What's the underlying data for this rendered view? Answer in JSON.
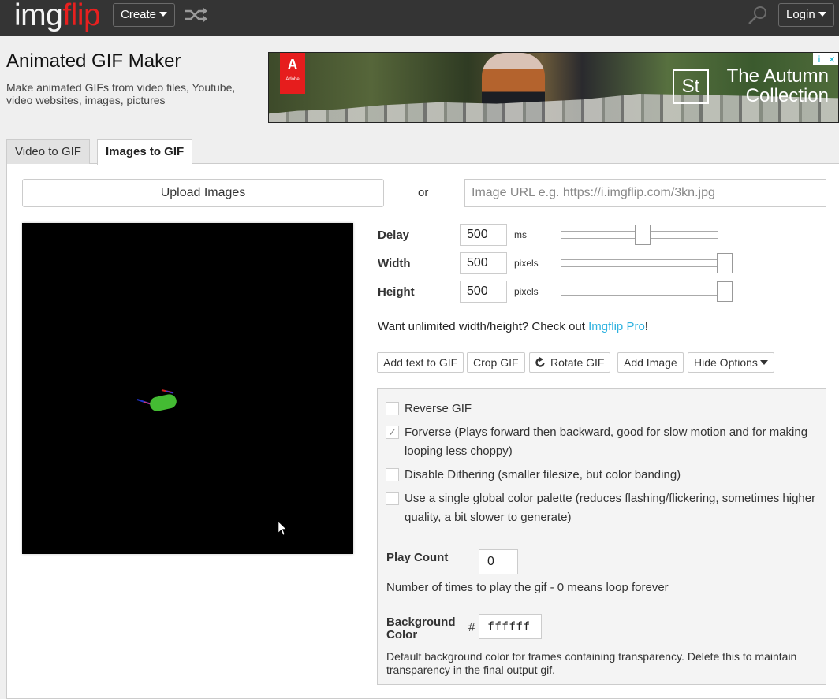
{
  "nav": {
    "logo_part1": "img",
    "logo_part2": "flip",
    "create_label": "Create",
    "login_label": "Login",
    "icons": [
      "shuffle-icon",
      "search-icon"
    ]
  },
  "header": {
    "title": "Animated GIF Maker",
    "subtitle": "Make animated GIFs from video files, Youtube, video websites, images, pictures"
  },
  "ad": {
    "brand": "Adobe",
    "brand_mark": "A",
    "product_mark": "St",
    "headline": "The Autumn Collection",
    "adchoices": "i",
    "close": "×"
  },
  "tabs": [
    {
      "label": "Video to GIF",
      "active": false
    },
    {
      "label": "Images to GIF",
      "active": true
    }
  ],
  "upload": {
    "button_label": "Upload Images",
    "or_label": "or",
    "url_placeholder": "Image URL e.g. https://i.imgflip.com/3kn.jpg",
    "url_value": ""
  },
  "settings": {
    "delay": {
      "label": "Delay",
      "value": "500",
      "unit": "ms",
      "slider_fraction": 0.5
    },
    "width": {
      "label": "Width",
      "value": "500",
      "unit": "pixels",
      "slider_fraction": 1.0
    },
    "height": {
      "label": "Height",
      "value": "500",
      "unit": "pixels",
      "slider_fraction": 1.0
    }
  },
  "promo": {
    "prefix": "Want unlimited width/height? Check out ",
    "link": "Imgflip Pro",
    "suffix": "!"
  },
  "actions": {
    "add_text": "Add text to GIF",
    "crop": "Crop GIF",
    "rotate": "Rotate GIF",
    "add_image": "Add Image",
    "hide_options": "Hide Options"
  },
  "options": {
    "checkboxes": [
      {
        "label": "Reverse GIF",
        "checked": false
      },
      {
        "label": "Forverse (Plays forward then backward, good for slow motion and for making looping less choppy)",
        "checked": true
      },
      {
        "label": "Disable Dithering (smaller filesize, but color banding)",
        "checked": false
      },
      {
        "label": "Use a single global color palette (reduces flashing/flickering, sometimes higher quality, a bit slower to generate)",
        "checked": false
      }
    ],
    "play_count": {
      "label": "Play Count",
      "value": "0",
      "help": "Number of times to play the gif - 0 means loop forever"
    },
    "background_color": {
      "label": "Background Color",
      "hash": "#",
      "value": "ffffff",
      "help": "Default background color for frames containing transparency. Delete this to maintain transparency in the final output gif."
    }
  },
  "colors": {
    "nav_bg": "#343434",
    "logo_red": "#e8201f",
    "link": "#2eb2e0",
    "page_bg": "#efefef",
    "preview_bg": "#000000",
    "options_bg": "#f4f4f4"
  }
}
